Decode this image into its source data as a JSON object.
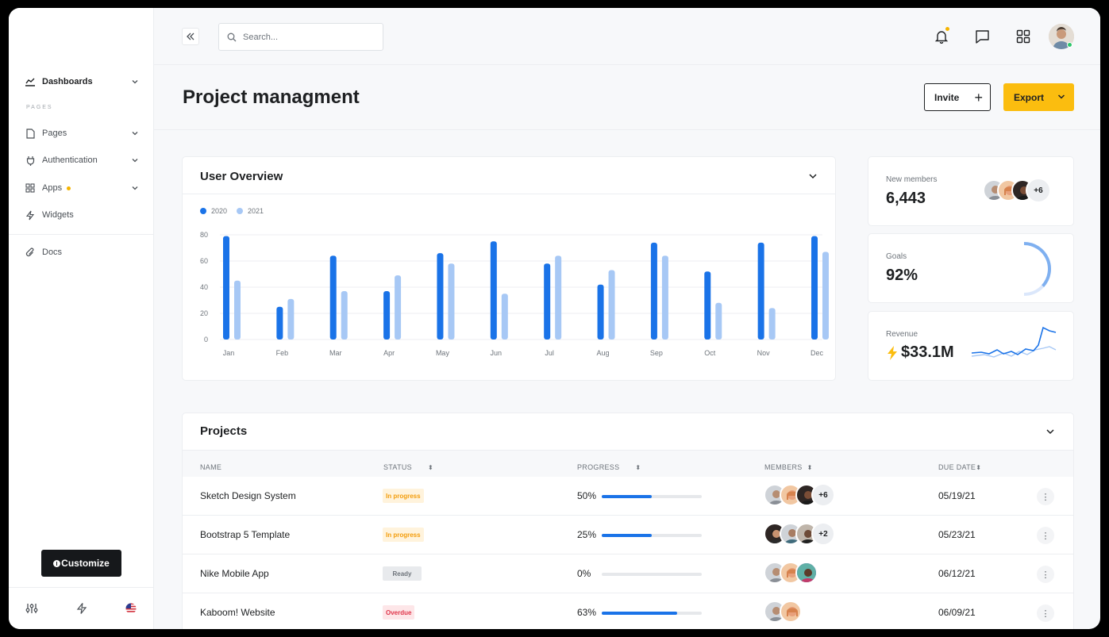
{
  "sidebar": {
    "items": [
      {
        "label": "Dashboards",
        "icon": "chart-line-icon"
      },
      {
        "label": "Pages",
        "icon": "file-icon"
      },
      {
        "label": "Authentication",
        "icon": "plug-icon"
      },
      {
        "label": "Apps",
        "icon": "grid-icon"
      },
      {
        "label": "Widgets",
        "icon": "bolt-icon"
      },
      {
        "label": "Docs",
        "icon": "paperclip-icon"
      }
    ],
    "section_label": "PAGES",
    "customize_label": "Customize"
  },
  "topbar": {
    "search_placeholder": "Search..."
  },
  "header": {
    "title": "Project managment",
    "invite_label": "Invite",
    "export_label": "Export"
  },
  "overview": {
    "title": "User Overview"
  },
  "chart_data": {
    "type": "bar",
    "categories": [
      "Jan",
      "Feb",
      "Mar",
      "Apr",
      "May",
      "Jun",
      "Jul",
      "Aug",
      "Sep",
      "Oct",
      "Nov",
      "Dec"
    ],
    "series": [
      {
        "name": "2020",
        "values": [
          79,
          25,
          64,
          37,
          66,
          75,
          58,
          42,
          74,
          52,
          74,
          79
        ],
        "color": "#1a73e8"
      },
      {
        "name": "2021",
        "values": [
          45,
          31,
          37,
          49,
          58,
          35,
          64,
          53,
          64,
          28,
          24,
          67
        ],
        "color": "#a7c8f5"
      }
    ],
    "ylim": [
      0,
      80
    ],
    "yticks": [
      "80",
      "60",
      "40",
      "20",
      "0"
    ],
    "grid": true,
    "legend": "top-left"
  },
  "stats": {
    "members_label": "New members",
    "members_value": "6,443",
    "members_more": "+6",
    "goals_label": "Goals",
    "goals_value": "92%",
    "goals_fraction": 0.92,
    "revenue_label": "Revenue",
    "revenue_value": "$33.1M"
  },
  "projects": {
    "title": "Projects",
    "columns": [
      "NAME",
      "STATUS",
      "PROGRESS",
      "MEMBERS",
      "DUE DATE"
    ],
    "rows": [
      {
        "name": "Sketch Design System",
        "status": "In progress",
        "status_type": "progress",
        "progress": "50%",
        "progress_value": 50,
        "more": "+6",
        "due": "05/19/21"
      },
      {
        "name": "Bootstrap 5 Template",
        "status": "In progress",
        "status_type": "progress",
        "progress": "25%",
        "progress_value": 50,
        "more": "+2",
        "due": "05/23/21"
      },
      {
        "name": "Nike Mobile App",
        "status": "Ready",
        "status_type": "ready",
        "progress": "0%",
        "progress_value": 0,
        "more": "",
        "due": "06/12/21"
      },
      {
        "name": "Kaboom! Website",
        "status": "Overdue",
        "status_type": "overdue",
        "progress": "63%",
        "progress_value": 75,
        "more": "",
        "due": "06/09/21"
      }
    ]
  }
}
